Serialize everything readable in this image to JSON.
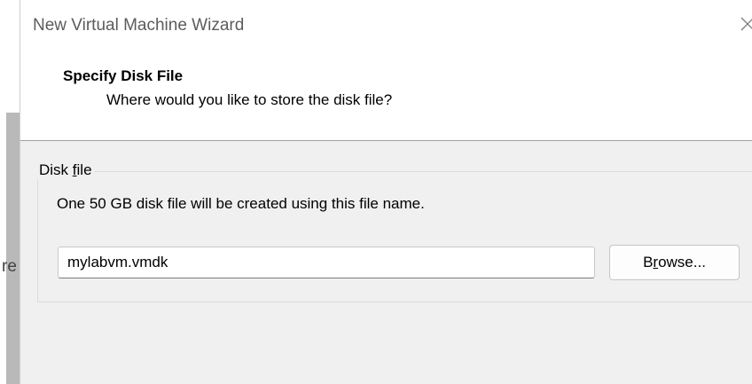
{
  "background": {
    "fragment_text": "re"
  },
  "dialog": {
    "title": "New Virtual Machine Wizard",
    "header": {
      "title": "Specify Disk File",
      "subtitle": "Where would you like to store the disk file?"
    },
    "disk_file_group": {
      "legend_pre": "Disk ",
      "legend_accel": "f",
      "legend_post": "ile",
      "description": "One 50 GB disk file will be created using this file name.",
      "file_name_value": "mylabvm.vmdk",
      "browse_pre": "B",
      "browse_accel": "r",
      "browse_post": "owse..."
    }
  },
  "colors": {
    "dialog_bg": "#f0f0f0",
    "header_bg": "#ffffff",
    "title_text": "#5c5c5c"
  },
  "icons": {
    "close": "close-icon"
  }
}
